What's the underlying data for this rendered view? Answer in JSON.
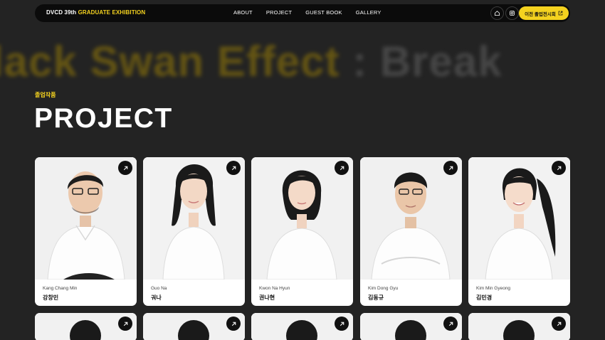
{
  "nav": {
    "brand_prefix": "DVCD 39th",
    "brand_highlight": "GRADUATE EXHIBITION",
    "menu": [
      "ABOUT",
      "PROJECT",
      "GUEST BOOK",
      "GALLERY"
    ],
    "prev_exhibition_label": "이전 졸업전시회",
    "colors": {
      "accent": "#f4d21f",
      "bar": "#0b0b0b"
    }
  },
  "marquee": {
    "text_highlight": "lack Swan Effect",
    "text_rest": " : Break"
  },
  "section": {
    "eyebrow": "졸업작품",
    "title": "PROJECT"
  },
  "cards": [
    {
      "en": "Kang Chang Min",
      "ko": "강창민"
    },
    {
      "en": "Guo Na",
      "ko": "궈나"
    },
    {
      "en": "Kwon Na Hyun",
      "ko": "권나현"
    },
    {
      "en": "Kim Dong Gyu",
      "ko": "김동규"
    },
    {
      "en": "Kim Min Gyeong",
      "ko": "김민경"
    }
  ]
}
